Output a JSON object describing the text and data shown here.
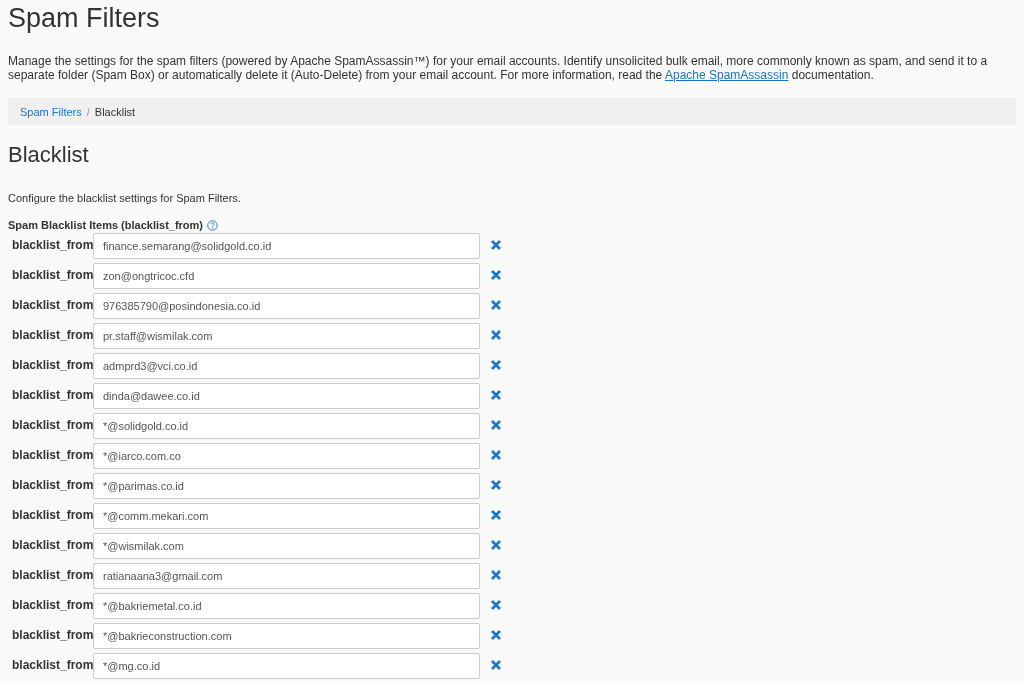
{
  "page_title": "Spam Filters",
  "description": {
    "before": "Manage the settings for the spam filters (powered by Apache SpamAssassin™) for your email accounts. Identify unsolicited bulk email, more commonly known as spam, and send it to a separate folder (Spam Box) or automatically delete it (Auto-Delete) from your email account. For more information, read the",
    "link": "Apache SpamAssassin",
    "after": "documentation."
  },
  "breadcrumb_separator": "/",
  "breadcrumb": [
    {
      "label": "Spam Filters",
      "selected": false
    },
    {
      "label": "Blacklist",
      "selected": true
    }
  ],
  "section_title": "Blacklist",
  "section_description": "Configure the blacklist settings for Spam Filters.",
  "items_label": "Spam Blacklist Items (blacklist_from)",
  "items": [
    {
      "label": "blacklist_from",
      "value": "finance.semarang@solidgold.co.id"
    },
    {
      "label": "blacklist_from",
      "value": "zon@ongtricoc.cfd"
    },
    {
      "label": "blacklist_from",
      "value": "976385790@posindonesia.co.id"
    },
    {
      "label": "blacklist_from",
      "value": "pr.staff@wismilak.com"
    },
    {
      "label": "blacklist_from",
      "value": "admprd3@vci.co.id"
    },
    {
      "label": "blacklist_from",
      "value": "dinda@dawee.co.id"
    },
    {
      "label": "blacklist_from",
      "value": "*@solidgold.co.id"
    },
    {
      "label": "blacklist_from",
      "value": "*@iarco.com.co"
    },
    {
      "label": "blacklist_from",
      "value": "*@parimas.co.id"
    },
    {
      "label": "blacklist_from",
      "value": "*@comm.mekari.com"
    },
    {
      "label": "blacklist_from",
      "value": "*@wismilak.com"
    },
    {
      "label": "blacklist_from",
      "value": "ratianaana3@gmail.com"
    },
    {
      "label": "blacklist_from",
      "value": "*@bakriemetal.co.id"
    },
    {
      "label": "blacklist_from",
      "value": "*@bakrieconstruction.com"
    },
    {
      "label": "blacklist_from",
      "value": "*@mg.co.id"
    }
  ]
}
